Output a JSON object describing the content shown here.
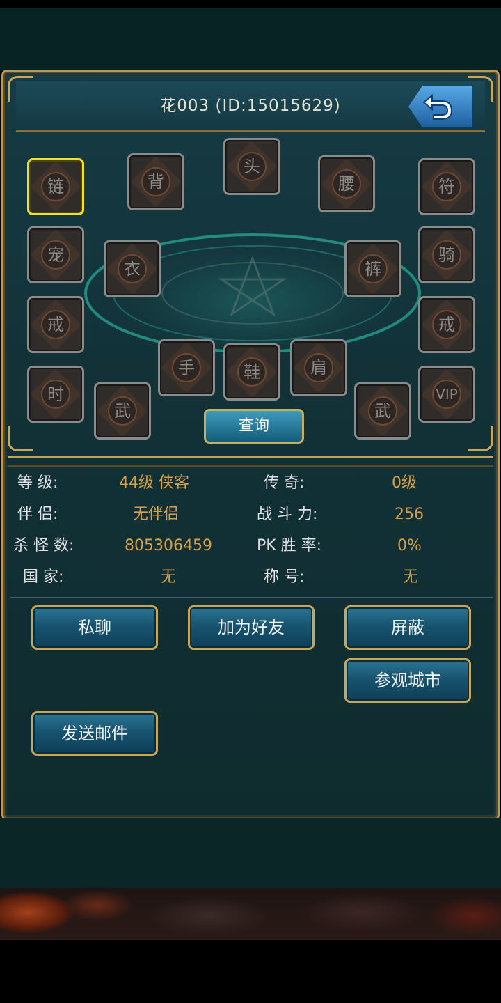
{
  "header": {
    "title": "花003 (ID:15015629)"
  },
  "equipment_slots": [
    {
      "id": "chain",
      "label": "链",
      "selected": true
    },
    {
      "id": "back",
      "label": "背"
    },
    {
      "id": "head",
      "label": "头"
    },
    {
      "id": "waist",
      "label": "腰"
    },
    {
      "id": "talisman",
      "label": "符"
    },
    {
      "id": "pet",
      "label": "宠"
    },
    {
      "id": "clothes",
      "label": "衣"
    },
    {
      "id": "pants",
      "label": "裤"
    },
    {
      "id": "mount",
      "label": "骑"
    },
    {
      "id": "ring-left",
      "label": "戒"
    },
    {
      "id": "ring-right",
      "label": "戒"
    },
    {
      "id": "hand",
      "label": "手"
    },
    {
      "id": "shoes",
      "label": "鞋"
    },
    {
      "id": "shoulder",
      "label": "肩"
    },
    {
      "id": "fashion",
      "label": "时"
    },
    {
      "id": "weapon-left",
      "label": "武"
    },
    {
      "id": "weapon-right",
      "label": "武"
    },
    {
      "id": "vip",
      "label": "VIP"
    }
  ],
  "query_button": "查询",
  "info": {
    "level_label": "等 级:",
    "level_value": "44级 侠客",
    "legend_label": "传 奇:",
    "legend_value": "0级",
    "partner_label": "伴 侣:",
    "partner_value": "无伴侣",
    "power_label": "战 斗 力:",
    "power_value": "256",
    "kills_label": "杀 怪 数:",
    "kills_value": "805306459",
    "pk_label": "PK 胜 率:",
    "pk_value": "0%",
    "country_label": "国 家:",
    "country_value": "无",
    "title_label": "称 号:",
    "title_value": "无"
  },
  "actions": {
    "private_chat": "私聊",
    "add_friend": "加为好友",
    "block": "屏蔽",
    "visit_city": "参观城市",
    "send_mail": "发送邮件"
  },
  "colors": {
    "frame_gold": "#c6a758",
    "selected_slot": "#f2e02a",
    "value_orange": "#d7a04a"
  }
}
